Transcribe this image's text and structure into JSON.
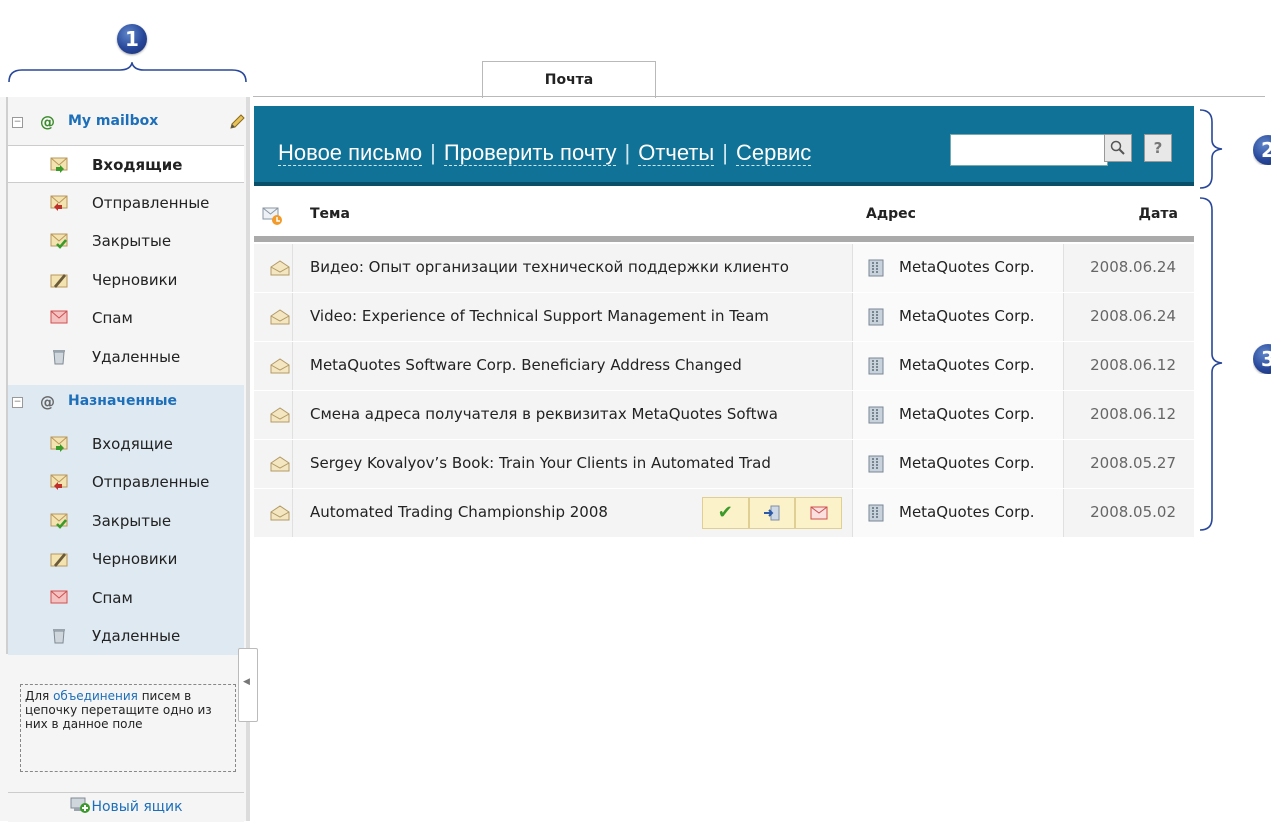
{
  "callouts": [
    "1",
    "2",
    "3"
  ],
  "tab": {
    "label": "Почта"
  },
  "mailboxes": [
    {
      "name": "My mailbox",
      "folders": [
        {
          "label": "Входящие",
          "icon": "inbox-icon",
          "selected": true
        },
        {
          "label": "Отправленные",
          "icon": "sent-icon"
        },
        {
          "label": "Закрытые",
          "icon": "closed-icon"
        },
        {
          "label": "Черновики",
          "icon": "drafts-icon"
        },
        {
          "label": "Спам",
          "icon": "spam-icon"
        },
        {
          "label": "Удаленные",
          "icon": "trash-icon"
        }
      ]
    },
    {
      "name": "Назначенные",
      "folders": [
        {
          "label": "Входящие",
          "icon": "inbox-icon"
        },
        {
          "label": "Отправленные",
          "icon": "sent-icon"
        },
        {
          "label": "Закрытые",
          "icon": "closed-icon"
        },
        {
          "label": "Черновики",
          "icon": "drafts-icon"
        },
        {
          "label": "Спам",
          "icon": "spam-icon"
        },
        {
          "label": "Удаленные",
          "icon": "trash-icon"
        }
      ]
    }
  ],
  "hint": {
    "before": "Для ",
    "link": "объединения",
    "after": " писем в цепочку перетащите одно из них в данное поле"
  },
  "new_mailbox_label": "Новый ящик",
  "toolbar": {
    "new_message": "Новое письмо",
    "check_mail": "Проверить почту",
    "reports": "Отчеты",
    "service": "Сервис",
    "separator": "|",
    "search_value": "",
    "help_label": "?"
  },
  "table": {
    "headers": {
      "subject": "Тема",
      "address": "Адрес",
      "date": "Дата"
    },
    "rows": [
      {
        "subject": "Видео: Опыт организации технической поддержки клиенто",
        "address": "MetaQuotes Corp.",
        "date": "2008.06.24"
      },
      {
        "subject": "Video: Experience of Technical Support Management in Team",
        "address": "MetaQuotes Corp.",
        "date": "2008.06.24"
      },
      {
        "subject": "MetaQuotes Software Corp. Beneficiary Address Changed",
        "address": "MetaQuotes Corp.",
        "date": "2008.06.12"
      },
      {
        "subject": "Смена адреса получателя в реквизитах MetaQuotes Softwa",
        "address": "MetaQuotes Corp.",
        "date": "2008.06.12"
      },
      {
        "subject": "Sergey Kovalyov’s Book: Train Your Clients in Automated Trad",
        "address": "MetaQuotes Corp.",
        "date": "2008.05.27"
      },
      {
        "subject": "Automated Trading Championship 2008",
        "address": "MetaQuotes Corp.",
        "date": "2008.05.02",
        "hovered": true
      }
    ]
  },
  "colors": {
    "toolbar": "#0f7296",
    "link": "#1d6fba",
    "callout": "#28479a"
  }
}
